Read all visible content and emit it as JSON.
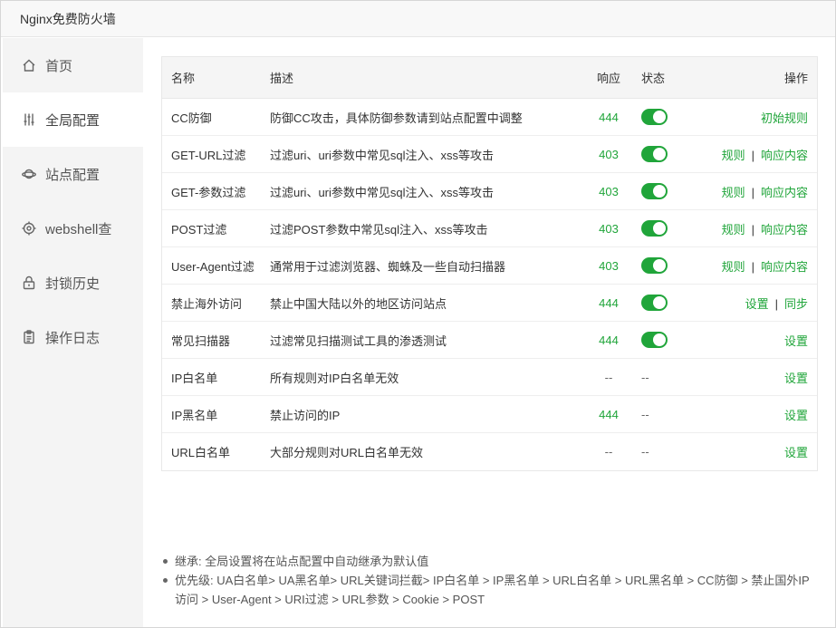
{
  "window": {
    "title": "Nginx免费防火墙"
  },
  "sidebar": {
    "items": [
      {
        "label": "首页",
        "icon": "home-icon"
      },
      {
        "label": "全局配置",
        "icon": "sliders-icon"
      },
      {
        "label": "站点配置",
        "icon": "planet-icon"
      },
      {
        "label": "webshell查",
        "icon": "target-icon"
      },
      {
        "label": "封锁历史",
        "icon": "lock-icon"
      },
      {
        "label": "操作日志",
        "icon": "clipboard-icon"
      }
    ],
    "active_index": 1
  },
  "table": {
    "headers": {
      "name": "名称",
      "desc": "描述",
      "code": "响应",
      "status": "状态",
      "ops": "操作"
    },
    "rows": [
      {
        "name": "CC防御",
        "desc": "防御CC攻击，具体防御参数请到站点配置中调整",
        "code": "444",
        "status": "on",
        "ops": [
          "初始规则"
        ]
      },
      {
        "name": "GET-URL过滤",
        "desc": "过滤uri、uri参数中常见sql注入、xss等攻击",
        "code": "403",
        "status": "on",
        "ops": [
          "规则",
          "响应内容"
        ]
      },
      {
        "name": "GET-参数过滤",
        "desc": "过滤uri、uri参数中常见sql注入、xss等攻击",
        "code": "403",
        "status": "on",
        "ops": [
          "规则",
          "响应内容"
        ]
      },
      {
        "name": "POST过滤",
        "desc": "过滤POST参数中常见sql注入、xss等攻击",
        "code": "403",
        "status": "on",
        "ops": [
          "规则",
          "响应内容"
        ]
      },
      {
        "name": "User-Agent过滤",
        "desc": "通常用于过滤浏览器、蜘蛛及一些自动扫描器",
        "code": "403",
        "status": "on",
        "ops": [
          "规则",
          "响应内容"
        ]
      },
      {
        "name": "禁止海外访问",
        "desc": "禁止中国大陆以外的地区访问站点",
        "code": "444",
        "status": "on",
        "ops": [
          "设置",
          "同步"
        ]
      },
      {
        "name": "常见扫描器",
        "desc": "过滤常见扫描测试工具的渗透测试",
        "code": "444",
        "status": "on",
        "ops": [
          "设置"
        ]
      },
      {
        "name": "IP白名单",
        "desc": "所有规则对IP白名单无效",
        "code": "--",
        "status": "--",
        "ops": [
          "设置"
        ]
      },
      {
        "name": "IP黑名单",
        "desc": "禁止访问的IP",
        "code": "444",
        "status": "--",
        "ops": [
          "设置"
        ]
      },
      {
        "name": "URL白名单",
        "desc": "大部分规则对URL白名单无效",
        "code": "--",
        "status": "--",
        "ops": [
          "设置"
        ]
      }
    ]
  },
  "notes": [
    "继承: 全局设置将在站点配置中自动继承为默认值",
    "优先级: UA白名单> UA黑名单> URL关键词拦截> IP白名单 > IP黑名单 > URL白名单 > URL黑名单 > CC防御 > 禁止国外IP访问 > User-Agent > URI过滤 > URL参数 > Cookie > POST"
  ],
  "colors": {
    "accent": "#20a53a",
    "sidebar_bg": "#f4f4f4",
    "header_bg": "#f5f5f5"
  }
}
